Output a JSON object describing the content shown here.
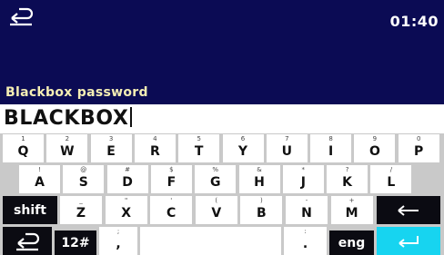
{
  "header": {
    "time": "01:40",
    "field_label": "Blackbox password"
  },
  "input": {
    "value": "BLACKBOX"
  },
  "keyboard": {
    "row1": [
      {
        "sec": "1",
        "main": "Q"
      },
      {
        "sec": "2",
        "main": "W"
      },
      {
        "sec": "3",
        "main": "E"
      },
      {
        "sec": "4",
        "main": "R"
      },
      {
        "sec": "5",
        "main": "T"
      },
      {
        "sec": "6",
        "main": "Y"
      },
      {
        "sec": "7",
        "main": "U"
      },
      {
        "sec": "8",
        "main": "I"
      },
      {
        "sec": "9",
        "main": "O"
      },
      {
        "sec": "0",
        "main": "P"
      }
    ],
    "row2": [
      {
        "sec": "!",
        "main": "A"
      },
      {
        "sec": "@",
        "main": "S"
      },
      {
        "sec": "#",
        "main": "D"
      },
      {
        "sec": "$",
        "main": "F"
      },
      {
        "sec": "%",
        "main": "G"
      },
      {
        "sec": "&",
        "main": "H"
      },
      {
        "sec": "*",
        "main": "J"
      },
      {
        "sec": "?",
        "main": "K"
      },
      {
        "sec": "/",
        "main": "L"
      }
    ],
    "row3": [
      {
        "sec": "_",
        "main": "Z"
      },
      {
        "sec": "\"",
        "main": "X"
      },
      {
        "sec": "'",
        "main": "C"
      },
      {
        "sec": "(",
        "main": "V"
      },
      {
        "sec": ")",
        "main": "B"
      },
      {
        "sec": "-",
        "main": "N"
      },
      {
        "sec": "+",
        "main": "M"
      }
    ],
    "shift_label": "shift",
    "numsym_label": "12#",
    "lang_label": "eng",
    "comma": {
      "sec": ";",
      "main": ","
    },
    "period": {
      "sec": ":",
      "main": "."
    }
  },
  "icons": {
    "back": "back-arrow-icon",
    "backspace": "left-arrow-icon",
    "enter": "enter-arrow-icon"
  },
  "colors": {
    "header_bg": "#0b0b54",
    "label": "#f5eeb4",
    "enter_key": "#17d4f0"
  }
}
